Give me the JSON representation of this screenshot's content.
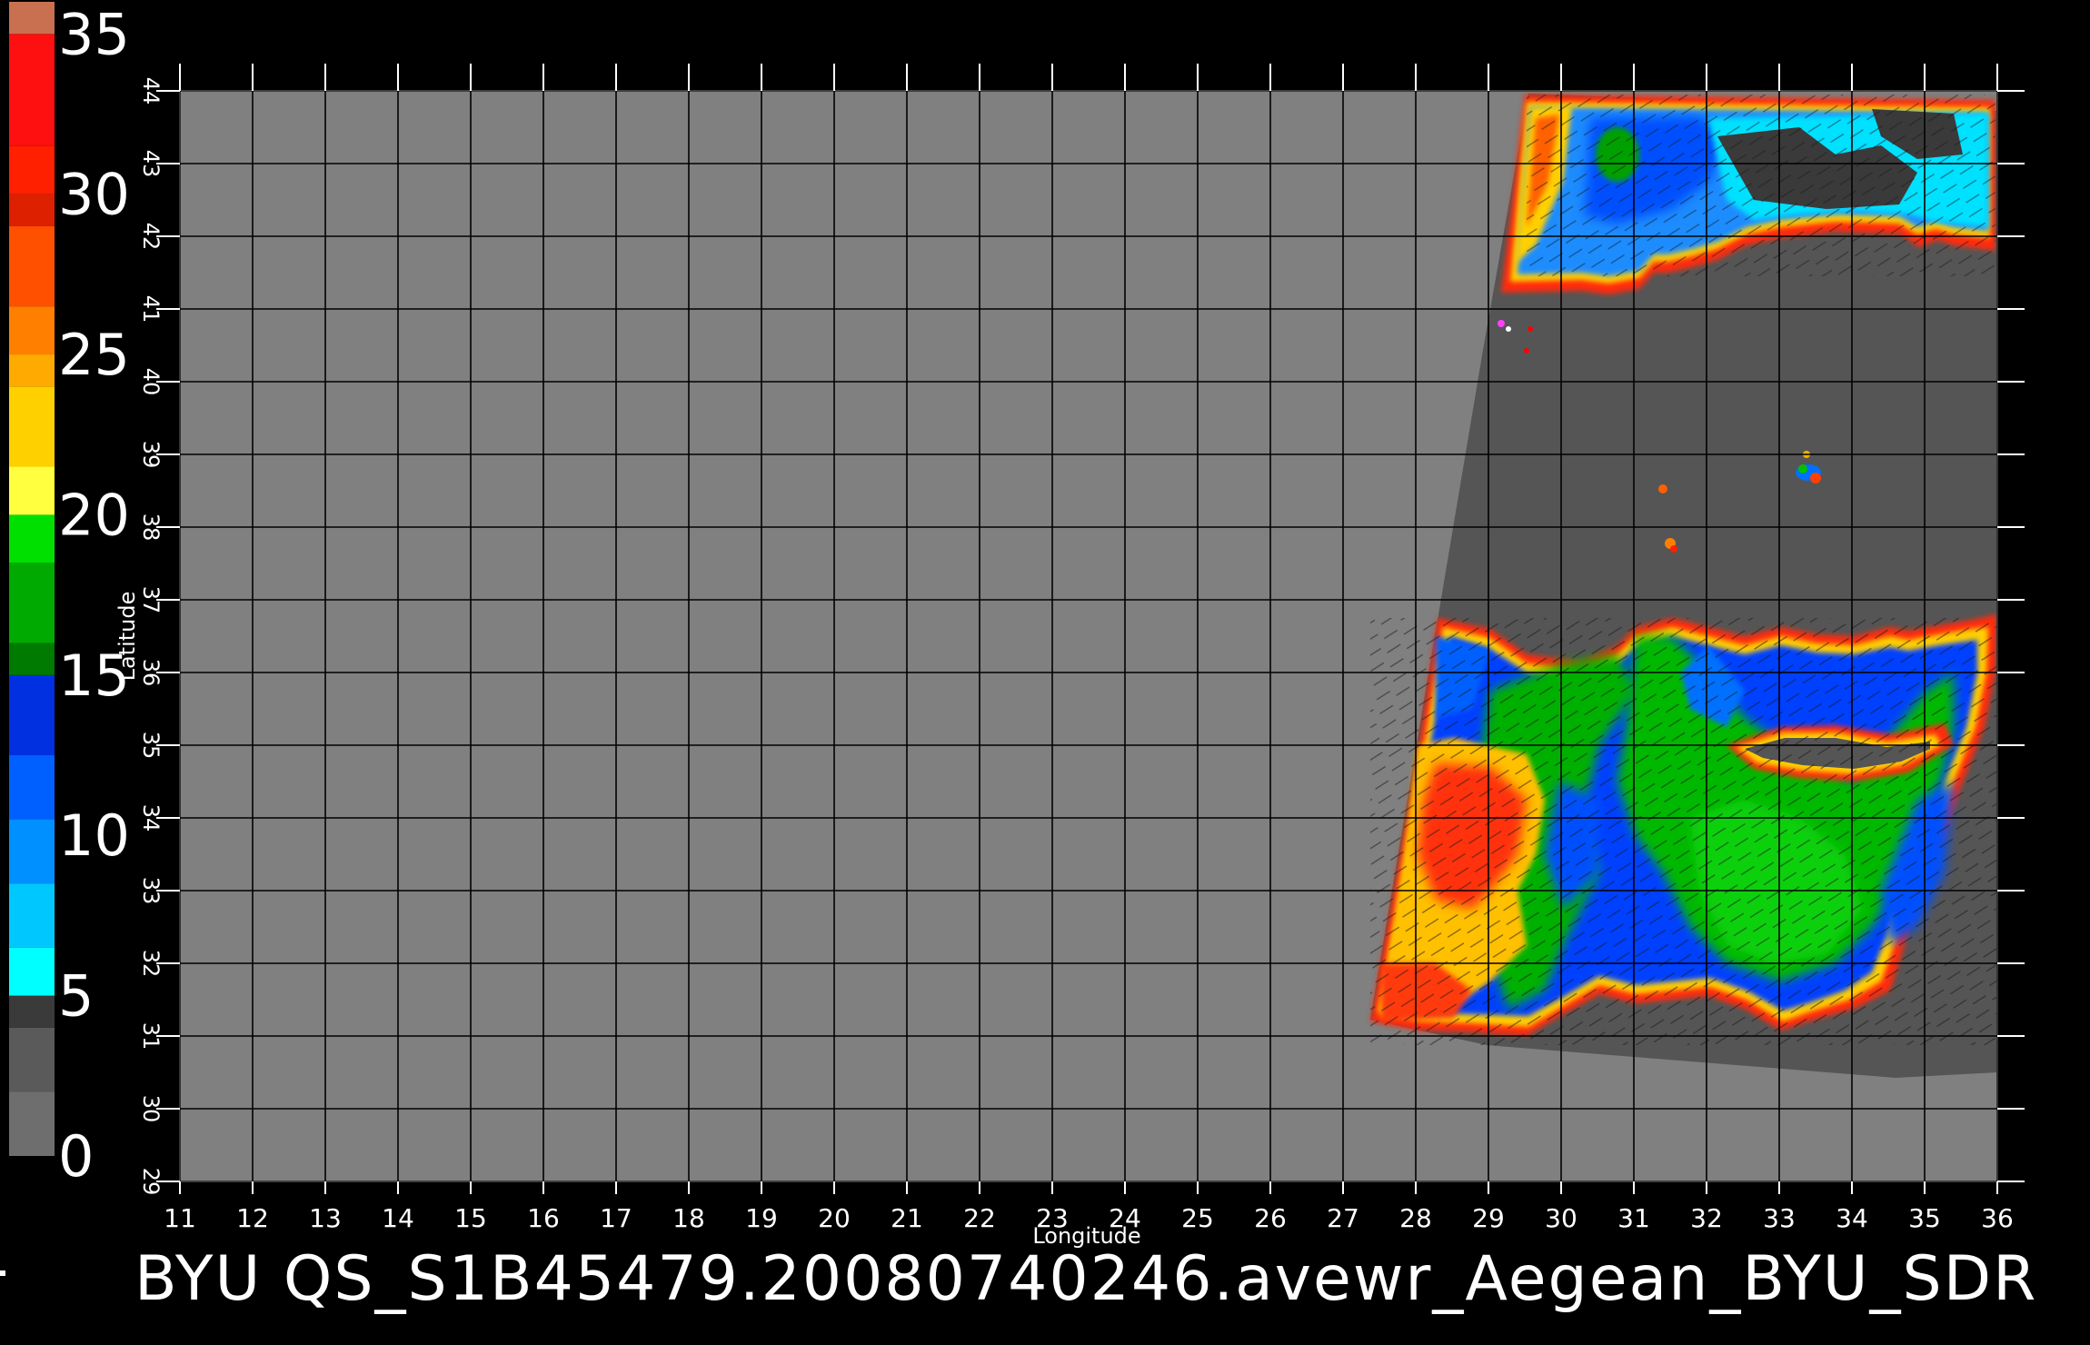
{
  "colorbar": {
    "ticks": [
      "0",
      "5",
      "10",
      "15",
      "20",
      "25",
      "30",
      "35"
    ],
    "min": 0,
    "max": 36,
    "stops": [
      {
        "from": 0,
        "to": 2,
        "color": "#6e6e6e"
      },
      {
        "from": 2,
        "to": 4,
        "color": "#5a5a5a"
      },
      {
        "from": 4,
        "to": 5,
        "color": "#3a3a3a"
      },
      {
        "from": 5,
        "to": 6.5,
        "color": "#00ffff"
      },
      {
        "from": 6.5,
        "to": 8.5,
        "color": "#00c8ff"
      },
      {
        "from": 8.5,
        "to": 10.5,
        "color": "#0090ff"
      },
      {
        "from": 10.5,
        "to": 12.5,
        "color": "#0060ff"
      },
      {
        "from": 12.5,
        "to": 15,
        "color": "#0030e0"
      },
      {
        "from": 15,
        "to": 16,
        "color": "#007a00"
      },
      {
        "from": 16,
        "to": 18.5,
        "color": "#00aa00"
      },
      {
        "from": 18.5,
        "to": 20,
        "color": "#00e000"
      },
      {
        "from": 20,
        "to": 21.5,
        "color": "#ffff40"
      },
      {
        "from": 21.5,
        "to": 24,
        "color": "#ffd000"
      },
      {
        "from": 24,
        "to": 25,
        "color": "#ffaa00"
      },
      {
        "from": 25,
        "to": 26.5,
        "color": "#ff8000"
      },
      {
        "from": 26.5,
        "to": 29,
        "color": "#ff5000"
      },
      {
        "from": 29,
        "to": 30,
        "color": "#dd2000"
      },
      {
        "from": 30,
        "to": 31.5,
        "color": "#ff2000"
      },
      {
        "from": 31.5,
        "to": 35,
        "color": "#ff1010"
      },
      {
        "from": 35,
        "to": 36,
        "color": "#c87050"
      }
    ]
  },
  "map": {
    "background_color": "#808080",
    "swath_color": "#555555",
    "grid_color": "#000000",
    "lon_range": [
      11,
      36
    ],
    "lat_range": [
      29,
      44
    ],
    "lon_ticks": [
      "11",
      "12",
      "13",
      "14",
      "15",
      "16",
      "17",
      "18",
      "19",
      "20",
      "21",
      "22",
      "23",
      "24",
      "25",
      "26",
      "27",
      "28",
      "29",
      "30",
      "31",
      "32",
      "33",
      "34",
      "35",
      "36"
    ],
    "lat_ticks": [
      "29",
      "30",
      "31",
      "32",
      "33",
      "34",
      "35",
      "36",
      "37",
      "38",
      "39",
      "40",
      "41",
      "42",
      "43",
      "44"
    ],
    "xlabel": "Longitude",
    "ylabel": "Latitude"
  },
  "caption": "BYU  QS_S1B45479.20080740246.avewr_Aegean_BYU_SDR"
}
